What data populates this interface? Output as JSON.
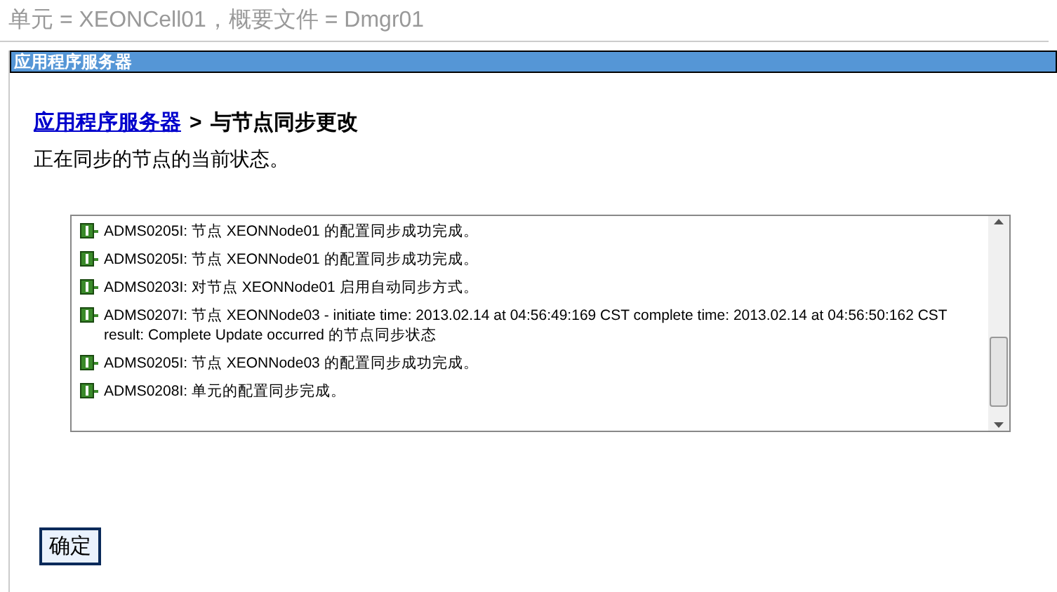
{
  "header": {
    "text": "单元 = XEONCell01，概要文件 = Dmgr01"
  },
  "panel": {
    "title": "应用程序服务器",
    "breadcrumb": {
      "link": "应用程序服务器",
      "separator": ">",
      "current": "与节点同步更改"
    },
    "description": "正在同步的节点的当前状态。",
    "messages": [
      {
        "kind": "info",
        "text": "ADMS0205I: 节点 XEONNode01 的配置同步成功完成。"
      },
      {
        "kind": "info",
        "text": "ADMS0205I: 节点 XEONNode01 的配置同步成功完成。"
      },
      {
        "kind": "info",
        "text": "ADMS0203I: 对节点 XEONNode01 启用自动同步方式。"
      },
      {
        "kind": "info",
        "text": "ADMS0207I: 节点 XEONNode03 - initiate time: 2013.02.14 at 04:56:49:169 CST complete time: 2013.02.14 at 04:56:50:162 CST result: Complete Update occurred 的节点同步状态"
      },
      {
        "kind": "info",
        "text": "ADMS0205I: 节点 XEONNode03 的配置同步成功完成。"
      },
      {
        "kind": "info",
        "text": "ADMS0208I: 单元的配置同步完成。"
      }
    ],
    "button": "确定"
  }
}
